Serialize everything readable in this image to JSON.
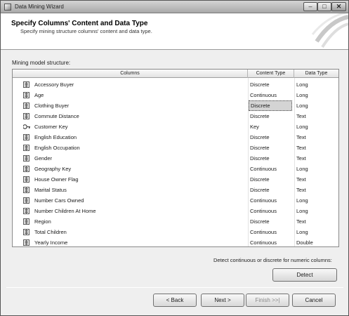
{
  "window": {
    "title": "Data Mining Wizard"
  },
  "header": {
    "title": "Specify Columns' Content and Data Type",
    "subtitle": "Specify mining structure columns' content and data type."
  },
  "section": {
    "label": "Mining model structure:"
  },
  "grid": {
    "headers": {
      "columns": "Columns",
      "content_type": "Content Type",
      "data_type": "Data Type"
    },
    "rows": [
      {
        "icon": "column-icon",
        "name": "Accessory Buyer",
        "content_type": "Discrete",
        "data_type": "Long"
      },
      {
        "icon": "column-icon",
        "name": "Age",
        "content_type": "Continuous",
        "data_type": "Long"
      },
      {
        "icon": "column-icon",
        "name": "Clothing Buyer",
        "content_type": "Discrete",
        "data_type": "Long"
      },
      {
        "icon": "column-icon",
        "name": "Commute Distance",
        "content_type": "Discrete",
        "data_type": "Text"
      },
      {
        "icon": "key-icon",
        "name": "Customer Key",
        "content_type": "Key",
        "data_type": "Long"
      },
      {
        "icon": "column-icon",
        "name": "English Education",
        "content_type": "Discrete",
        "data_type": "Text"
      },
      {
        "icon": "column-icon",
        "name": "English Occupation",
        "content_type": "Discrete",
        "data_type": "Text"
      },
      {
        "icon": "column-icon",
        "name": "Gender",
        "content_type": "Discrete",
        "data_type": "Text"
      },
      {
        "icon": "column-icon",
        "name": "Geography Key",
        "content_type": "Continuous",
        "data_type": "Long"
      },
      {
        "icon": "column-icon",
        "name": "House Owner Flag",
        "content_type": "Discrete",
        "data_type": "Text"
      },
      {
        "icon": "column-icon",
        "name": "Marital Status",
        "content_type": "Discrete",
        "data_type": "Text"
      },
      {
        "icon": "column-icon",
        "name": "Number Cars Owned",
        "content_type": "Continuous",
        "data_type": "Long"
      },
      {
        "icon": "column-icon",
        "name": "Number Children At Home",
        "content_type": "Continuous",
        "data_type": "Long"
      },
      {
        "icon": "column-icon",
        "name": "Region",
        "content_type": "Discrete",
        "data_type": "Text"
      },
      {
        "icon": "column-icon",
        "name": "Total Children",
        "content_type": "Continuous",
        "data_type": "Long"
      },
      {
        "icon": "column-icon",
        "name": "Yearly Income",
        "content_type": "Continuous",
        "data_type": "Double"
      }
    ],
    "selected_row": 2
  },
  "detect": {
    "label": "Detect continuous or discrete for numeric columns:",
    "button": "Detect"
  },
  "nav": {
    "back": "< Back",
    "next": "Next >",
    "finish": "Finish >>|",
    "cancel": "Cancel"
  }
}
